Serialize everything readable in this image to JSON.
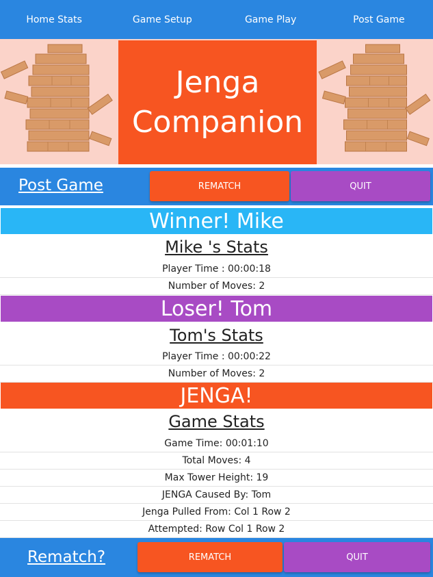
{
  "nav": {
    "items": [
      {
        "label": "Home Stats"
      },
      {
        "label": "Game Setup"
      },
      {
        "label": "Game Play"
      },
      {
        "label": "Post Game"
      }
    ]
  },
  "hero": {
    "title_line1": "Jenga",
    "title_line2": "Companion"
  },
  "top_bar": {
    "title": "Post Game",
    "rematch_label": "REMATCH",
    "quit_label": "QUIT"
  },
  "winner": {
    "banner": "Winner! Mike",
    "stats_heading": "Mike 's Stats",
    "player_time": "Player Time : 00:00:18",
    "moves": "Number of Moves: 2"
  },
  "loser": {
    "banner": "Loser! Tom",
    "stats_heading": "Tom's Stats",
    "player_time": "Player Time : 00:00:22",
    "moves": "Number of Moves: 2"
  },
  "jenga": {
    "banner": "JENGA!",
    "stats_heading": "Game Stats",
    "game_time": "Game Time: 00:01:10",
    "total_moves": "Total Moves: 4",
    "max_height": "Max Tower Height: 19",
    "caused_by": "JENGA Caused By: Tom",
    "pulled_from": "Jenga Pulled From: Col 1 Row 2",
    "attempted": "Attempted: Row Col 1 Row 2"
  },
  "bottom_bar": {
    "title": "Rematch?",
    "rematch_label": "REMATCH",
    "quit_label": "QUIT"
  },
  "colors": {
    "nav_blue": "#2a86e0",
    "orange": "#f75521",
    "purple": "#a84bc4",
    "light_blue": "#29b6f6",
    "hero_bg": "#fbd3c9"
  }
}
